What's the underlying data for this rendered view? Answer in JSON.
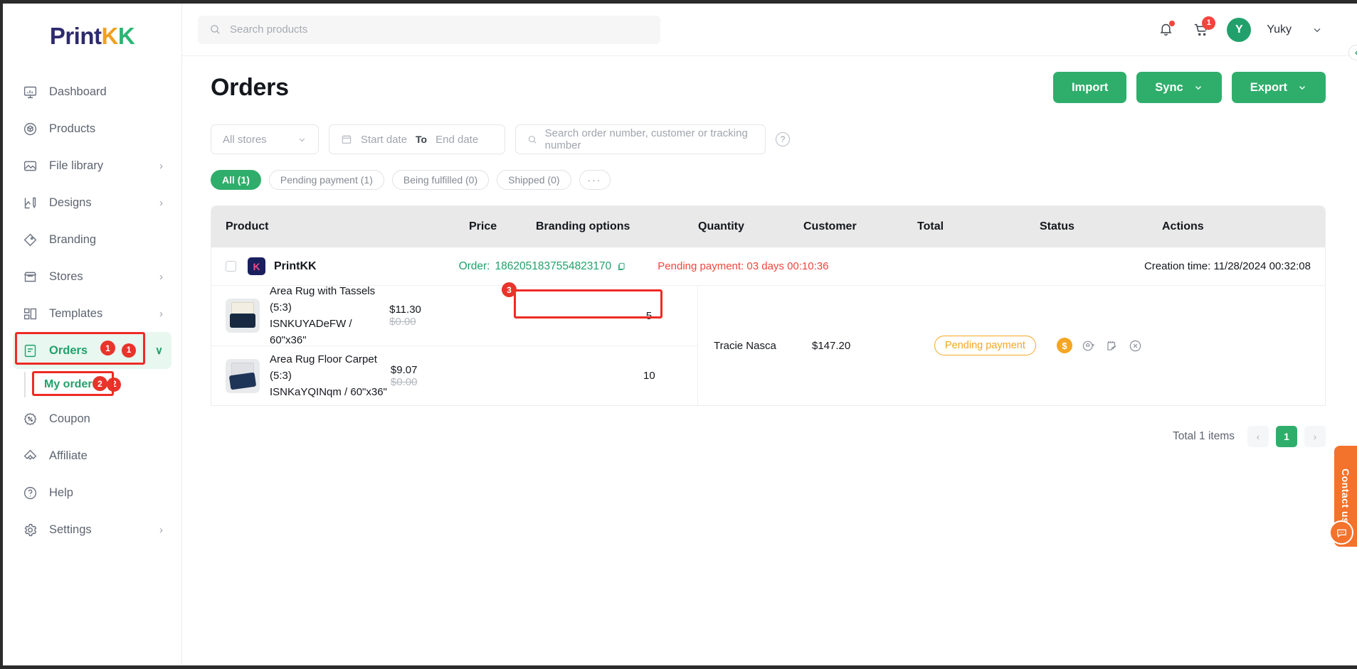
{
  "brand": {
    "name_part1": "Print",
    "name_k1": "K",
    "name_k2": "K",
    "accent_green": "#2fae6b",
    "accent_red": "#e8342a",
    "accent_orange": "#f5a623"
  },
  "sidebar": {
    "collapse_icon": "chevron-left",
    "items": [
      {
        "label": "Dashboard",
        "icon": "dashboard-icon",
        "chevron": "",
        "badge": ""
      },
      {
        "label": "Products",
        "icon": "products-icon",
        "chevron": "",
        "badge": ""
      },
      {
        "label": "File library",
        "icon": "file-library-icon",
        "chevron": "›",
        "badge": ""
      },
      {
        "label": "Designs",
        "icon": "designs-icon",
        "chevron": "›",
        "badge": ""
      },
      {
        "label": "Branding",
        "icon": "branding-icon",
        "chevron": "",
        "badge": ""
      },
      {
        "label": "Stores",
        "icon": "stores-icon",
        "chevron": "›",
        "badge": ""
      },
      {
        "label": "Templates",
        "icon": "templates-icon",
        "chevron": "›",
        "badge": ""
      },
      {
        "label": "Orders",
        "icon": "orders-icon",
        "chevron": "∨",
        "badge": "1"
      },
      {
        "label": "Coupon",
        "icon": "coupon-icon",
        "chevron": "",
        "badge": ""
      },
      {
        "label": "Affiliate",
        "icon": "affiliate-icon",
        "chevron": "",
        "badge": ""
      },
      {
        "label": "Help",
        "icon": "help-icon",
        "chevron": "",
        "badge": ""
      },
      {
        "label": "Settings",
        "icon": "settings-icon",
        "chevron": "›",
        "badge": ""
      }
    ],
    "submenu": {
      "label": "My orders",
      "badge": "2"
    }
  },
  "annotations": {
    "orders_num": "1",
    "my_orders_num": "2",
    "order_number_num": "3"
  },
  "header": {
    "search_placeholder": "Search products",
    "search_value": "",
    "notifications_icon": "bell-icon",
    "cart_icon": "cart-icon",
    "cart_badge": "1",
    "avatar_initial": "Y",
    "user_name": "Yuky",
    "user_chevron": "∨"
  },
  "page": {
    "title": "Orders",
    "buttons": [
      {
        "label": "Import",
        "chevron": ""
      },
      {
        "label": "Sync",
        "chevron": "∨"
      },
      {
        "label": "Export",
        "chevron": "∨"
      }
    ]
  },
  "filters": {
    "store_select": "All stores",
    "store_chevron": "∨",
    "calendar_icon": "calendar-icon",
    "start_date_placeholder": "Start date",
    "to_label": "To",
    "end_date_placeholder": "End date",
    "search_placeholder": "Search order number, customer or tracking number",
    "help_icon": "question-mark-icon"
  },
  "tabs": [
    {
      "label": "All (1)",
      "active": true
    },
    {
      "label": "Pending payment (1)",
      "active": false
    },
    {
      "label": "Being fulfilled (0)",
      "active": false
    },
    {
      "label": "Shipped (0)",
      "active": false
    },
    {
      "label": "···",
      "active": false
    }
  ],
  "table": {
    "columns": [
      "Product",
      "Price",
      "Branding options",
      "Quantity",
      "Customer",
      "Total",
      "Status",
      "Actions"
    ],
    "order": {
      "store_logo_letter": "K",
      "store_name": "PrintKK",
      "order_label": "Order:",
      "order_number": "1862051837554823170",
      "copy_icon": "copy-icon",
      "pending_text": "Pending payment:  03 days 00:10:36",
      "creation_text": "Creation time: 11/28/2024 00:32:08",
      "items": [
        {
          "name": "Area Rug with Tassels (5:3)",
          "sku": "ISNKUYADeFW / 60\"x36\"",
          "price": "$11.30",
          "price_old": "$0.00",
          "quantity": "5",
          "branding": ""
        },
        {
          "name": "Area Rug Floor Carpet (5:3)",
          "sku": "ISNKaYQINqm / 60\"x36\"",
          "price": "$9.07",
          "price_old": "$0.00",
          "quantity": "10",
          "branding": ""
        }
      ],
      "customer": "Tracie Nasca",
      "total": "$147.20",
      "status": "Pending payment",
      "actions": [
        {
          "icon": "pay-coin-icon",
          "name": "pay-action"
        },
        {
          "icon": "refund-icon",
          "name": "refund-action"
        },
        {
          "icon": "edit-note-icon",
          "name": "edit-note-action"
        },
        {
          "icon": "cancel-icon",
          "name": "cancel-action"
        }
      ]
    }
  },
  "pagination": {
    "total_label": "Total 1 items",
    "prev": "‹",
    "current": "1",
    "next": "›"
  },
  "contact": {
    "label": "Contact us",
    "bubble_icon": "chat-icon"
  }
}
